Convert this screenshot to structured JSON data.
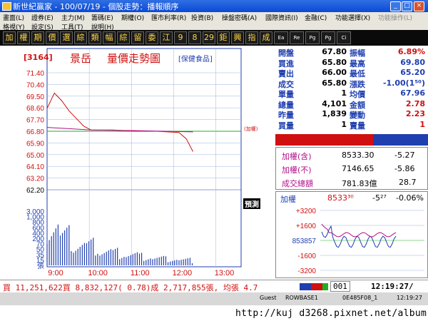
{
  "window": {
    "title": "新世紀贏家 - 100/07/19 - 個股走勢：播報順序",
    "minimize": "_",
    "maximize": "□",
    "close": "×"
  },
  "menus": {
    "row1": [
      "畫面(L)",
      "證券(E)",
      "主力(M)",
      "籌碼(E)",
      "期權(O)",
      "匯市利率(R)",
      "投資(B)",
      "操盤密碼(A)",
      "國際資訊(I)",
      "金融(C)",
      "功能選擇(X)",
      "功能操作(L)"
    ],
    "row2": [
      "格視(Y)",
      "設定(S)",
      "工具(T)",
      "說明(H)"
    ]
  },
  "toolbar": [
    "加",
    "權",
    "期",
    "價",
    "選",
    "綜",
    "類",
    "幅",
    "綜",
    "留",
    "委",
    "江",
    "9",
    "8",
    "29",
    "鉅",
    "興",
    "指",
    "成",
    "Ea",
    "Re",
    "Pg",
    "Pg",
    "Ci"
  ],
  "chart": {
    "code": "[3164]",
    "name": "景岳",
    "title": "量價走勢圖",
    "category": "[保健食品]",
    "ref_line_note": "(加權)",
    "price_ticks": [
      "71.40",
      "70.40",
      "69.50",
      "68.60",
      "67.70",
      "66.80",
      "65.90",
      "65.00",
      "64.10",
      "63.20",
      "62.20"
    ],
    "volume_ticks": [
      "3,000",
      "1,000",
      "800",
      "600",
      "400",
      "200",
      "70",
      "50",
      "35",
      "15",
      "張"
    ],
    "time_ticks": [
      "9:00",
      "10:00",
      "11:00",
      "12:00",
      "13:00"
    ],
    "alert_label": "預測"
  },
  "chart_data": {
    "type": "line",
    "title": "量價走勢圖",
    "xlabel": "",
    "ylabel": "",
    "x": [
      "9:00",
      "9:10",
      "9:20",
      "9:30",
      "9:40",
      "9:50",
      "10:00",
      "10:30",
      "11:00",
      "11:30",
      "12:00",
      "12:10",
      "12:19"
    ],
    "ylim": [
      62.2,
      71.4
    ],
    "series": [
      {
        "values": [
          68.6,
          69.8,
          69.2,
          68.4,
          67.8,
          67.2,
          66.9,
          66.9,
          66.8,
          66.8,
          66.7,
          66.2,
          65.2
        ]
      }
    ],
    "avg_price": 67.96,
    "volume": [
      120,
      80,
      60,
      55,
      40,
      35,
      30,
      25,
      20,
      18,
      15,
      12,
      10
    ]
  },
  "quote": {
    "open_label": "開盤",
    "open": "67.80",
    "amp_label": "振幅",
    "amp": "6.89%",
    "bid_label": "買進",
    "bid": "65.80",
    "high_label": "最高",
    "high": "69.80",
    "ask_label": "賣出",
    "ask": "66.00",
    "low_label": "最低",
    "low": "65.20",
    "trade_label": "成交",
    "trade": "65.80",
    "chg_label": "漲跌",
    "chg": "-1.00(1⁵⁰)",
    "single_label": "單量",
    "single": "1",
    "avg_label": "均價",
    "avg": "67.96",
    "total_label": "總量",
    "total": "4,101",
    "amount_label": "金額",
    "amount": "2.78",
    "yday_label": "昨量",
    "yday": "1,839",
    "turnover_label": "變動",
    "turnover": "2.23",
    "buyvol_label": "買量",
    "buyvol": "1",
    "sellvol_label": "賣量",
    "sellvol": "1"
  },
  "index_box": {
    "row1_label": "加權(含)",
    "row1_val": "8533.30",
    "row1_chg": "-5.27",
    "row2_label": "加權(不)",
    "row2_val": "7146.65",
    "row2_chg": "-5.86",
    "row3_label": "成交總額",
    "row3_val": "781.83億",
    "row3_chg": "28.7"
  },
  "mini_chart": {
    "label": "加權",
    "value": "8533³⁰",
    "chg": "-5²⁷",
    "pct": "-0.06%",
    "ticks": [
      "+3200",
      "+1600",
      "853857",
      "-1600",
      "-3200"
    ]
  },
  "bottom": {
    "ticker": "買 11,251,622買 8,832,127( 0.78)成 2,717,855張, 均張 4.7",
    "box_value": "001",
    "clock": "12:19:27/"
  },
  "status": [
    "Guest",
    "ROWBASE1",
    "0E485F08_1",
    "12:19:27"
  ],
  "footer": {
    "watermark": "http://kuj d3268.pixnet.net/album"
  }
}
